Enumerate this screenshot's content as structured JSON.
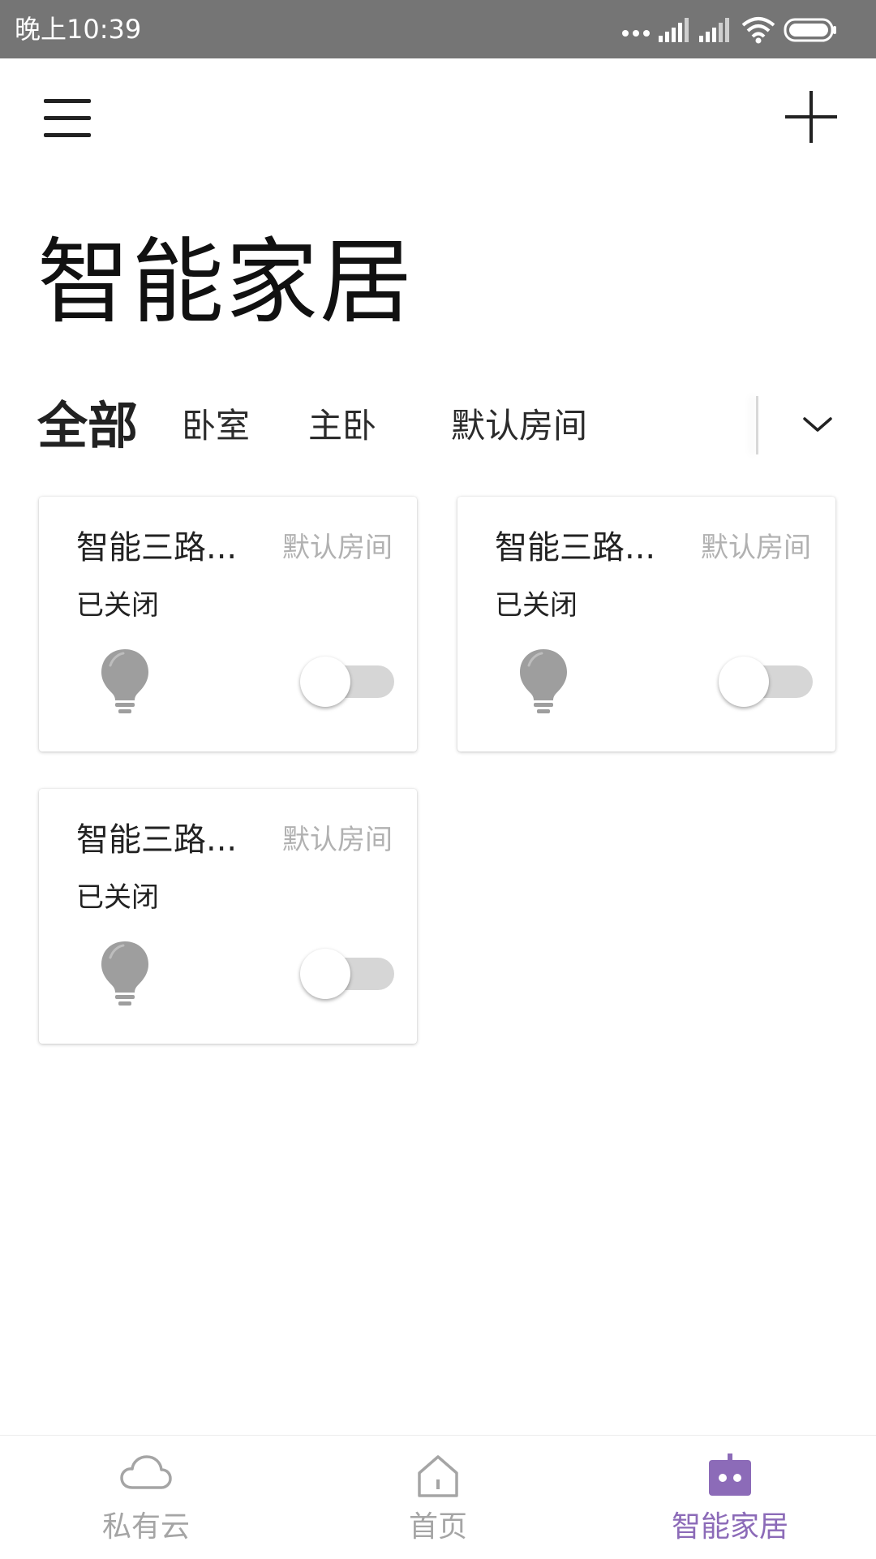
{
  "status_bar": {
    "time": "晚上10:39"
  },
  "page": {
    "title": "智能家居"
  },
  "tabs": [
    {
      "label": "全部",
      "active": true
    },
    {
      "label": "卧室",
      "active": false
    },
    {
      "label": "主卧",
      "active": false
    },
    {
      "label": "默认房间",
      "active": false
    }
  ],
  "devices": [
    {
      "name": "智能三路...",
      "room": "默认房间",
      "state": "已关闭",
      "on": false
    },
    {
      "name": "智能三路...",
      "room": "默认房间",
      "state": "已关闭",
      "on": false
    },
    {
      "name": "智能三路...",
      "room": "默认房间",
      "state": "已关闭",
      "on": false
    }
  ],
  "bottom_nav": [
    {
      "label": "私有云",
      "icon": "cloud-icon",
      "active": false
    },
    {
      "label": "首页",
      "icon": "home-icon",
      "active": false
    },
    {
      "label": "智能家居",
      "icon": "robot-icon",
      "active": true
    }
  ],
  "colors": {
    "status_bar": "#757575",
    "accent": "#8c6bb8",
    "inactive": "#a5a5a5",
    "bulb_off": "#9e9e9e",
    "switch_track": "#d6d6d6"
  }
}
